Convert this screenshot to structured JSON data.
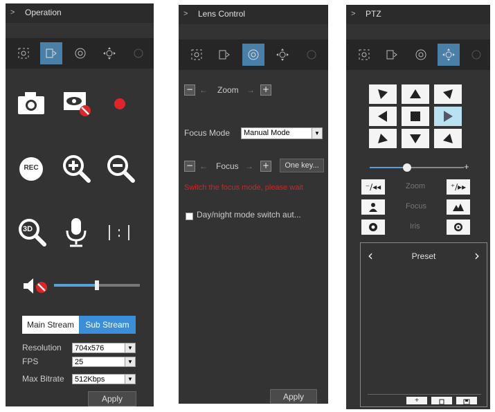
{
  "operation": {
    "title": "Operation",
    "stream_main": "Main Stream",
    "stream_sub": "Sub Stream",
    "resolution_label": "Resolution",
    "resolution_value": "704x576",
    "fps_label": "FPS",
    "fps_value": "25",
    "bitrate_label": "Max Bitrate",
    "bitrate_value": "512Kbps",
    "apply": "Apply",
    "rec_label": "REC",
    "threed_label": "3D",
    "volume_level": 0.5
  },
  "lens": {
    "title": "Lens Control",
    "zoom_label": "Zoom",
    "focus_mode_label": "Focus Mode",
    "focus_mode_value": "Manual Mode",
    "focus_label": "Focus",
    "one_key": "One key...",
    "warning": "Switch the focus mode, please wait",
    "daynight_label": "Day/night mode switch aut...",
    "apply": "Apply"
  },
  "ptz": {
    "title": "PTZ",
    "zoom_label": "Zoom",
    "focus_label": "Focus",
    "iris_label": "Iris",
    "preset_label": "Preset",
    "speed_level": 0.4
  },
  "colors": {
    "panel_bg": "#333333",
    "accent": "#4a7fa8",
    "highlight": "#3a8fd8",
    "record_red": "#e0242a"
  }
}
